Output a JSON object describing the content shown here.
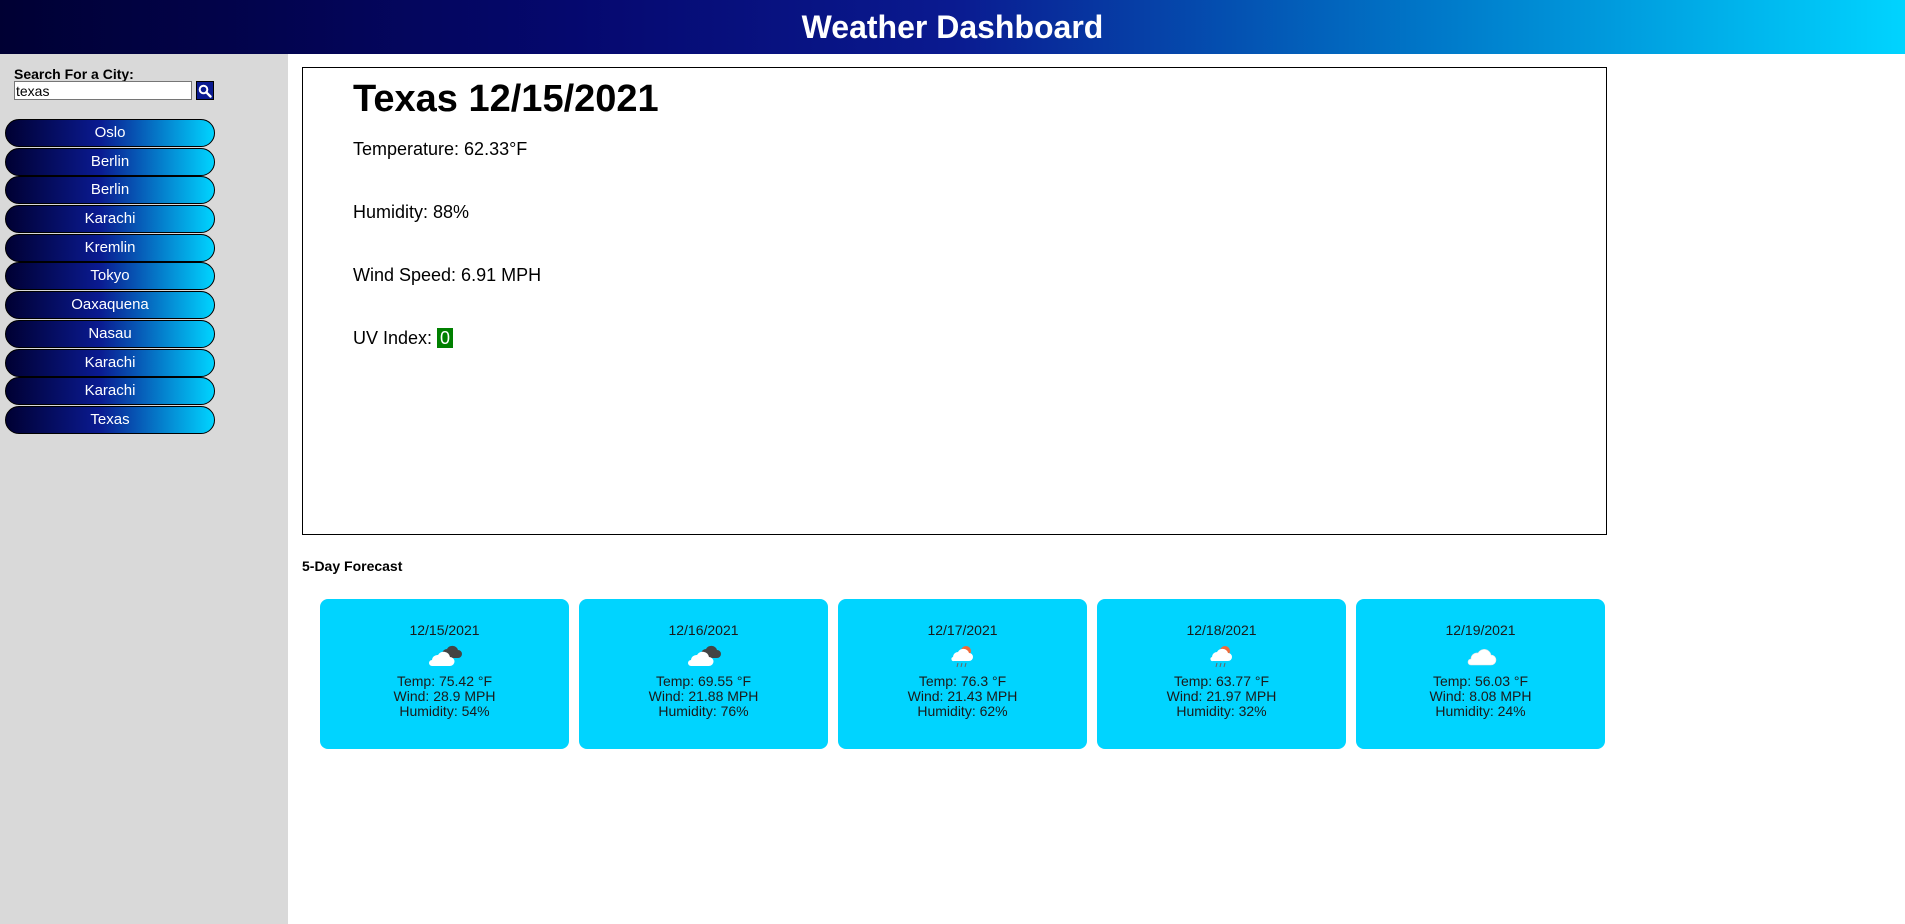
{
  "header": {
    "title": "Weather Dashboard"
  },
  "sidebar": {
    "search_label": "Search For a City:",
    "search_value": "texas",
    "search_icon": "search-icon",
    "cities": [
      "Oslo",
      "Berlin",
      "Berlin",
      "Karachi",
      "Kremlin",
      "Tokyo",
      "Oaxaquena",
      "Nasau",
      "Karachi",
      "Karachi",
      "Texas"
    ]
  },
  "current": {
    "title": "Texas 12/15/2021",
    "temperature": "Temperature: 62.33°F",
    "humidity": "Humidity: 88%",
    "wind": "Wind Speed: 6.91 MPH",
    "uv_label": "UV Index: ",
    "uv_value": "0",
    "uv_color": "#008000"
  },
  "forecast": {
    "title": "5-Day Forecast",
    "days": [
      {
        "date": "12/15/2021",
        "icon": "broken-clouds-icon",
        "temp": "Temp: 75.42 °F",
        "wind": "Wind: 28.9 MPH",
        "humidity": "Humidity: 54%"
      },
      {
        "date": "12/16/2021",
        "icon": "broken-clouds-icon",
        "temp": "Temp: 69.55 °F",
        "wind": "Wind: 21.88 MPH",
        "humidity": "Humidity: 76%"
      },
      {
        "date": "12/17/2021",
        "icon": "sun-rain-cloud-icon",
        "temp": "Temp: 76.3 °F",
        "wind": "Wind: 21.43 MPH",
        "humidity": "Humidity: 62%"
      },
      {
        "date": "12/18/2021",
        "icon": "sun-rain-cloud-icon",
        "temp": "Temp: 63.77 °F",
        "wind": "Wind: 21.97 MPH",
        "humidity": "Humidity: 32%"
      },
      {
        "date": "12/19/2021",
        "icon": "cloud-icon",
        "temp": "Temp: 56.03 °F",
        "wind": "Wind: 8.08 MPH",
        "humidity": "Humidity: 24%"
      }
    ]
  },
  "colors": {
    "card_bg": "#00d4ff",
    "sidebar_bg": "#d9d9d9"
  }
}
